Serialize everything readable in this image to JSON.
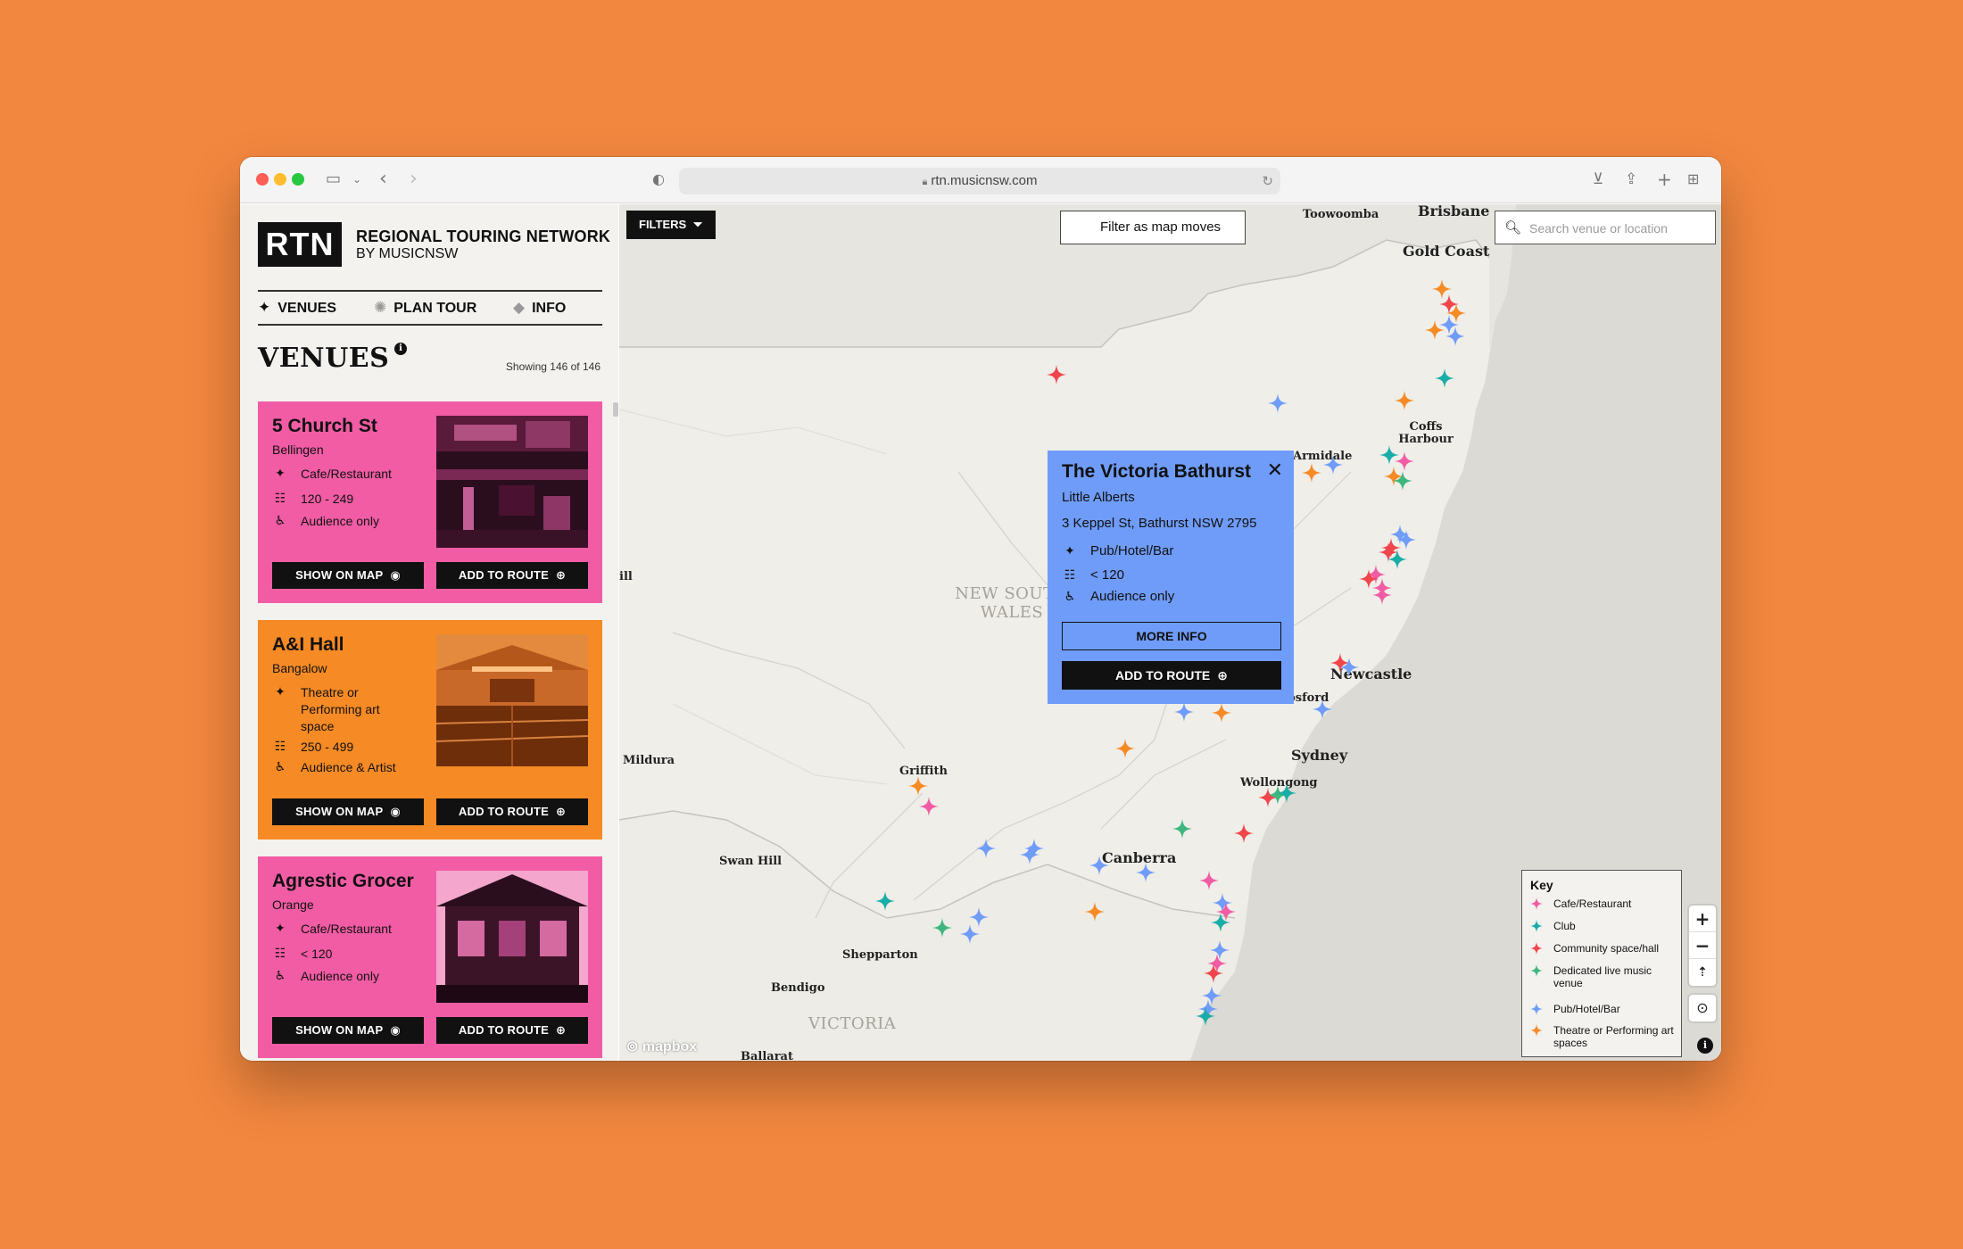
{
  "browser": {
    "url": "rtn.musicnsw.com"
  },
  "sidebar": {
    "logo": "RTN",
    "brand_title": "REGIONAL TOURING NETWORK",
    "brand_sub": "BY MUSICNSW",
    "nav": [
      {
        "label": "VENUES",
        "icon": "star-icon"
      },
      {
        "label": "PLAN TOUR",
        "icon": "burst-icon"
      },
      {
        "label": "INFO",
        "icon": "diamond-icon"
      }
    ],
    "heading": "VENUES",
    "showing": "Showing 146 of 146",
    "show_on_map_label": "SHOW ON MAP",
    "add_to_route_label": "ADD TO ROUTE"
  },
  "venues": [
    {
      "name": "5 Church St",
      "town": "Bellingen",
      "type": "Cafe/Restaurant",
      "capacity": "120 - 249",
      "access": "Audience only",
      "color": "#F15CA4"
    },
    {
      "name": "A&I Hall",
      "town": "Bangalow",
      "type": "Theatre or Performing art space",
      "capacity": "250 - 499",
      "access": "Audience & Artist",
      "color": "#F68A25"
    },
    {
      "name": "Agrestic Grocer",
      "town": "Orange",
      "type": "Cafe/Restaurant",
      "capacity": "< 120",
      "access": "Audience only",
      "color": "#F15CA4"
    }
  ],
  "map": {
    "filters_label": "FILTERS",
    "filter_as_map_moves": "Filter as map moves",
    "search_placeholder": "Search venue or location",
    "mapbox_label": "mapbox",
    "attribution_label": "i",
    "places": {
      "toowoomba": "Toowoomba",
      "brisbane": "Brisbane",
      "gold_coast": "Gold Coast",
      "coffs_harbour": "Coffs Harbour",
      "armidale": "Armidale",
      "newcastle": "Newcastle",
      "gosford": "Gosford",
      "sydney": "Sydney",
      "wollongong": "Wollongong",
      "canberra": "Canberra",
      "griffith": "Griffith",
      "mildura": "Mildura",
      "swan_hill": "Swan Hill",
      "shepparton": "Shepparton",
      "bendigo": "Bendigo",
      "ballarat": "Ballarat",
      "broken_hill_partial": "ill"
    },
    "regions": {
      "nsw": "NEW SOUTH WALES",
      "victoria": "VICTORIA"
    }
  },
  "popup": {
    "title": "The Victoria Bathurst",
    "subtitle": "Little Alberts",
    "address": "3 Keppel St, Bathurst NSW 2795",
    "type": "Pub/Hotel/Bar",
    "capacity": "< 120",
    "access": "Audience only",
    "more_info_label": "MORE INFO",
    "add_to_route_label": "ADD TO ROUTE",
    "color": "#6F9CF8"
  },
  "key": {
    "title": "Key",
    "items": [
      {
        "label": "Cafe/Restaurant",
        "color": "#F15CA4"
      },
      {
        "label": "Club",
        "color": "#1AADA8"
      },
      {
        "label": "Community space/hall",
        "color": "#F0454B"
      },
      {
        "label": "Dedicated live music venue",
        "color": "#3DB77E"
      },
      {
        "label": "Pub/Hotel/Bar",
        "color": "#6F9CF8"
      },
      {
        "label": "Theatre or Performing art spaces",
        "color": "#F68A25"
      }
    ]
  },
  "colors": {
    "page_bg": "#F2873F",
    "cafe": "#F15CA4",
    "club": "#1AADA8",
    "community": "#F0454B",
    "live_music": "#3DB77E",
    "pub": "#6F9CF8",
    "theatre": "#F68A25"
  }
}
